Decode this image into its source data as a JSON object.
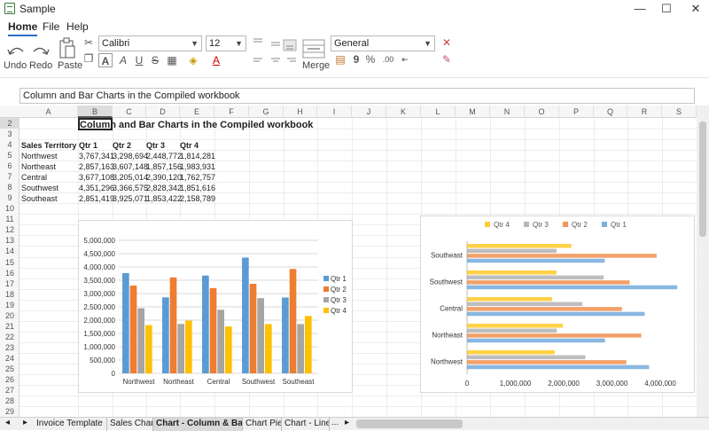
{
  "window": {
    "title": "Sample",
    "minimize": "—",
    "maximize": "☐",
    "close": "✕"
  },
  "menu": {
    "home": "Home",
    "file": "File",
    "help": "Help"
  },
  "ribbon": {
    "undo": "Undo",
    "redo": "Redo",
    "paste": "Paste",
    "merge": "Merge",
    "font": "Calibri",
    "font_size": "12",
    "number_format": "General",
    "bold_glyph": "A",
    "italic_glyph": "A",
    "underline_glyph": "U",
    "strike_glyph": "S",
    "font_color_glyph": "A",
    "comma_glyph": "9",
    "percent_glyph": "%",
    "inc_decimal_glyph": ".00"
  },
  "formula_bar": {
    "value": "Column and Bar Charts in the Compiled workbook"
  },
  "columns": [
    "A",
    "B",
    "C",
    "D",
    "E",
    "F",
    "G",
    "H",
    "I",
    "J",
    "K",
    "L",
    "M",
    "N",
    "O",
    "P",
    "Q",
    "R",
    "S"
  ],
  "rows": [
    "2",
    "3",
    "4",
    "5",
    "6",
    "7",
    "8",
    "9",
    "10",
    "11",
    "12",
    "13",
    "14",
    "15",
    "16",
    "17",
    "18",
    "19",
    "20",
    "21",
    "22",
    "23",
    "24",
    "25",
    "26",
    "27",
    "28",
    "29"
  ],
  "sheet": {
    "title": "Column and Bar Charts in the Compiled workbook",
    "headers": [
      "Sales Territory",
      "Qtr 1",
      "Qtr 2",
      "Qtr 3",
      "Qtr 4"
    ],
    "table": [
      [
        "Northwest",
        "3,767,341",
        "3,298,694",
        "2,448,772",
        "1,814,281"
      ],
      [
        "Northeast",
        "2,857,163",
        "3,607,148",
        "1,857,156",
        "1,983,931"
      ],
      [
        "Central",
        "3,677,108",
        "3,205,014",
        "2,390,120",
        "1,762,757"
      ],
      [
        "Southwest",
        "4,351,296",
        "3,366,575",
        "2,828,342",
        "1,851,616"
      ],
      [
        "Southeast",
        "2,851,419",
        "3,925,071",
        "1,853,422",
        "2,158,789"
      ]
    ]
  },
  "colors": {
    "qtr1": "#5b9bd5",
    "qtr2": "#ed7d31",
    "qtr3": "#a5a5a5",
    "qtr4": "#ffc000",
    "accent": "#2b6cc4"
  },
  "chart_data": [
    {
      "type": "bar",
      "orientation": "vertical",
      "categories": [
        "Northwest",
        "Northeast",
        "Central",
        "Southwest",
        "Southeast"
      ],
      "series": [
        {
          "name": "Qtr 1",
          "values": [
            3767341,
            2857163,
            3677108,
            4351296,
            2851419
          ]
        },
        {
          "name": "Qtr 2",
          "values": [
            3298694,
            3607148,
            3205014,
            3366575,
            3925071
          ]
        },
        {
          "name": "Qtr 3",
          "values": [
            2448772,
            1857156,
            2390120,
            2828342,
            1853422
          ]
        },
        {
          "name": "Qtr 4",
          "values": [
            1814281,
            1983931,
            1762757,
            1851616,
            2158789
          ]
        }
      ],
      "yticks": [
        "0",
        "500,000",
        "1,000,000",
        "1,500,000",
        "2,000,000",
        "2,500,000",
        "3,000,000",
        "3,500,000",
        "4,000,000",
        "4,500,000",
        "5,000,000"
      ],
      "ylim": [
        0,
        5000000
      ],
      "legend": "right",
      "grid": true
    },
    {
      "type": "bar",
      "orientation": "horizontal",
      "categories": [
        "Northwest",
        "Northeast",
        "Central",
        "Southwest",
        "Southeast"
      ],
      "series": [
        {
          "name": "Qtr 1",
          "values": [
            3767341,
            2857163,
            3677108,
            4351296,
            2851419
          ]
        },
        {
          "name": "Qtr 2",
          "values": [
            3298694,
            3607148,
            3205014,
            3366575,
            3925071
          ]
        },
        {
          "name": "Qtr 3",
          "values": [
            2448772,
            1857156,
            2390120,
            2828342,
            1853422
          ]
        },
        {
          "name": "Qtr 4",
          "values": [
            1814281,
            1983931,
            1762757,
            1851616,
            2158789
          ]
        }
      ],
      "legend_order": [
        "Qtr 4",
        "Qtr 3",
        "Qtr 2",
        "Qtr 1"
      ],
      "xticks": [
        "0",
        "1,000,000",
        "2,000,000",
        "3,000,000",
        "4,000,000"
      ],
      "xlim": [
        0,
        4000000
      ],
      "legend": "top",
      "grid": false
    }
  ],
  "tabs": [
    {
      "label": "Invoice Template",
      "active": false
    },
    {
      "label": "Sales Chart",
      "active": false
    },
    {
      "label": "Chart - Column & Bar",
      "active": true
    },
    {
      "label": "Chart Pie",
      "active": false
    },
    {
      "label": "Chart - Line",
      "active": false
    }
  ],
  "tab_nav": {
    "prev": "◂",
    "next": "▸",
    "more": "..."
  }
}
